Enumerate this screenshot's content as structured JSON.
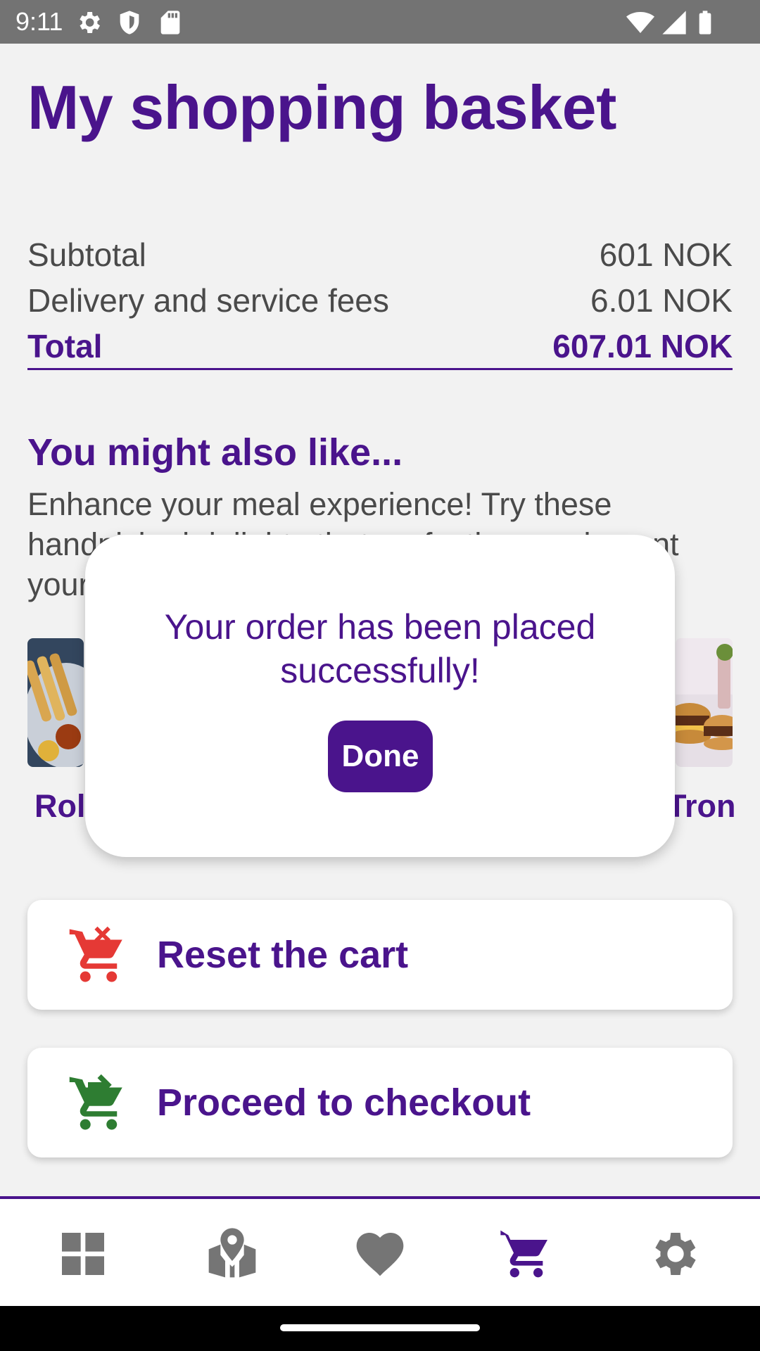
{
  "status_bar": {
    "time": "9:11",
    "icons": [
      "settings-icon",
      "shield-icon",
      "sd-card-icon",
      "wifi-icon",
      "signal-icon",
      "battery-icon"
    ]
  },
  "page": {
    "title": "My shopping basket"
  },
  "summary": {
    "subtotal_label": "Subtotal",
    "subtotal_value": "601 NOK",
    "fees_label": "Delivery and service fees",
    "fees_value": "6.01 NOK",
    "total_label": "Total",
    "total_value": "607.01 NOK"
  },
  "recommendations": {
    "title": "You might also like...",
    "description": "Enhance your meal experience! Try these handpicked delights that perfectly complement your",
    "items": [
      {
        "label": "Rol"
      },
      {
        "label": "Tron"
      }
    ]
  },
  "dialog": {
    "message": "Your order has been placed successfully!",
    "button": "Done"
  },
  "actions": {
    "reset_label": "Reset the cart",
    "checkout_label": "Proceed to checkout"
  },
  "bottom_nav": {
    "items": [
      "dashboard-icon",
      "map-icon",
      "heart-icon",
      "cart-icon",
      "settings-icon"
    ],
    "active": "cart-icon"
  },
  "colors": {
    "primary": "#4a148c",
    "reset_icon": "#e53935",
    "checkout_icon": "#2e7d32",
    "nav_inactive": "#757575"
  }
}
